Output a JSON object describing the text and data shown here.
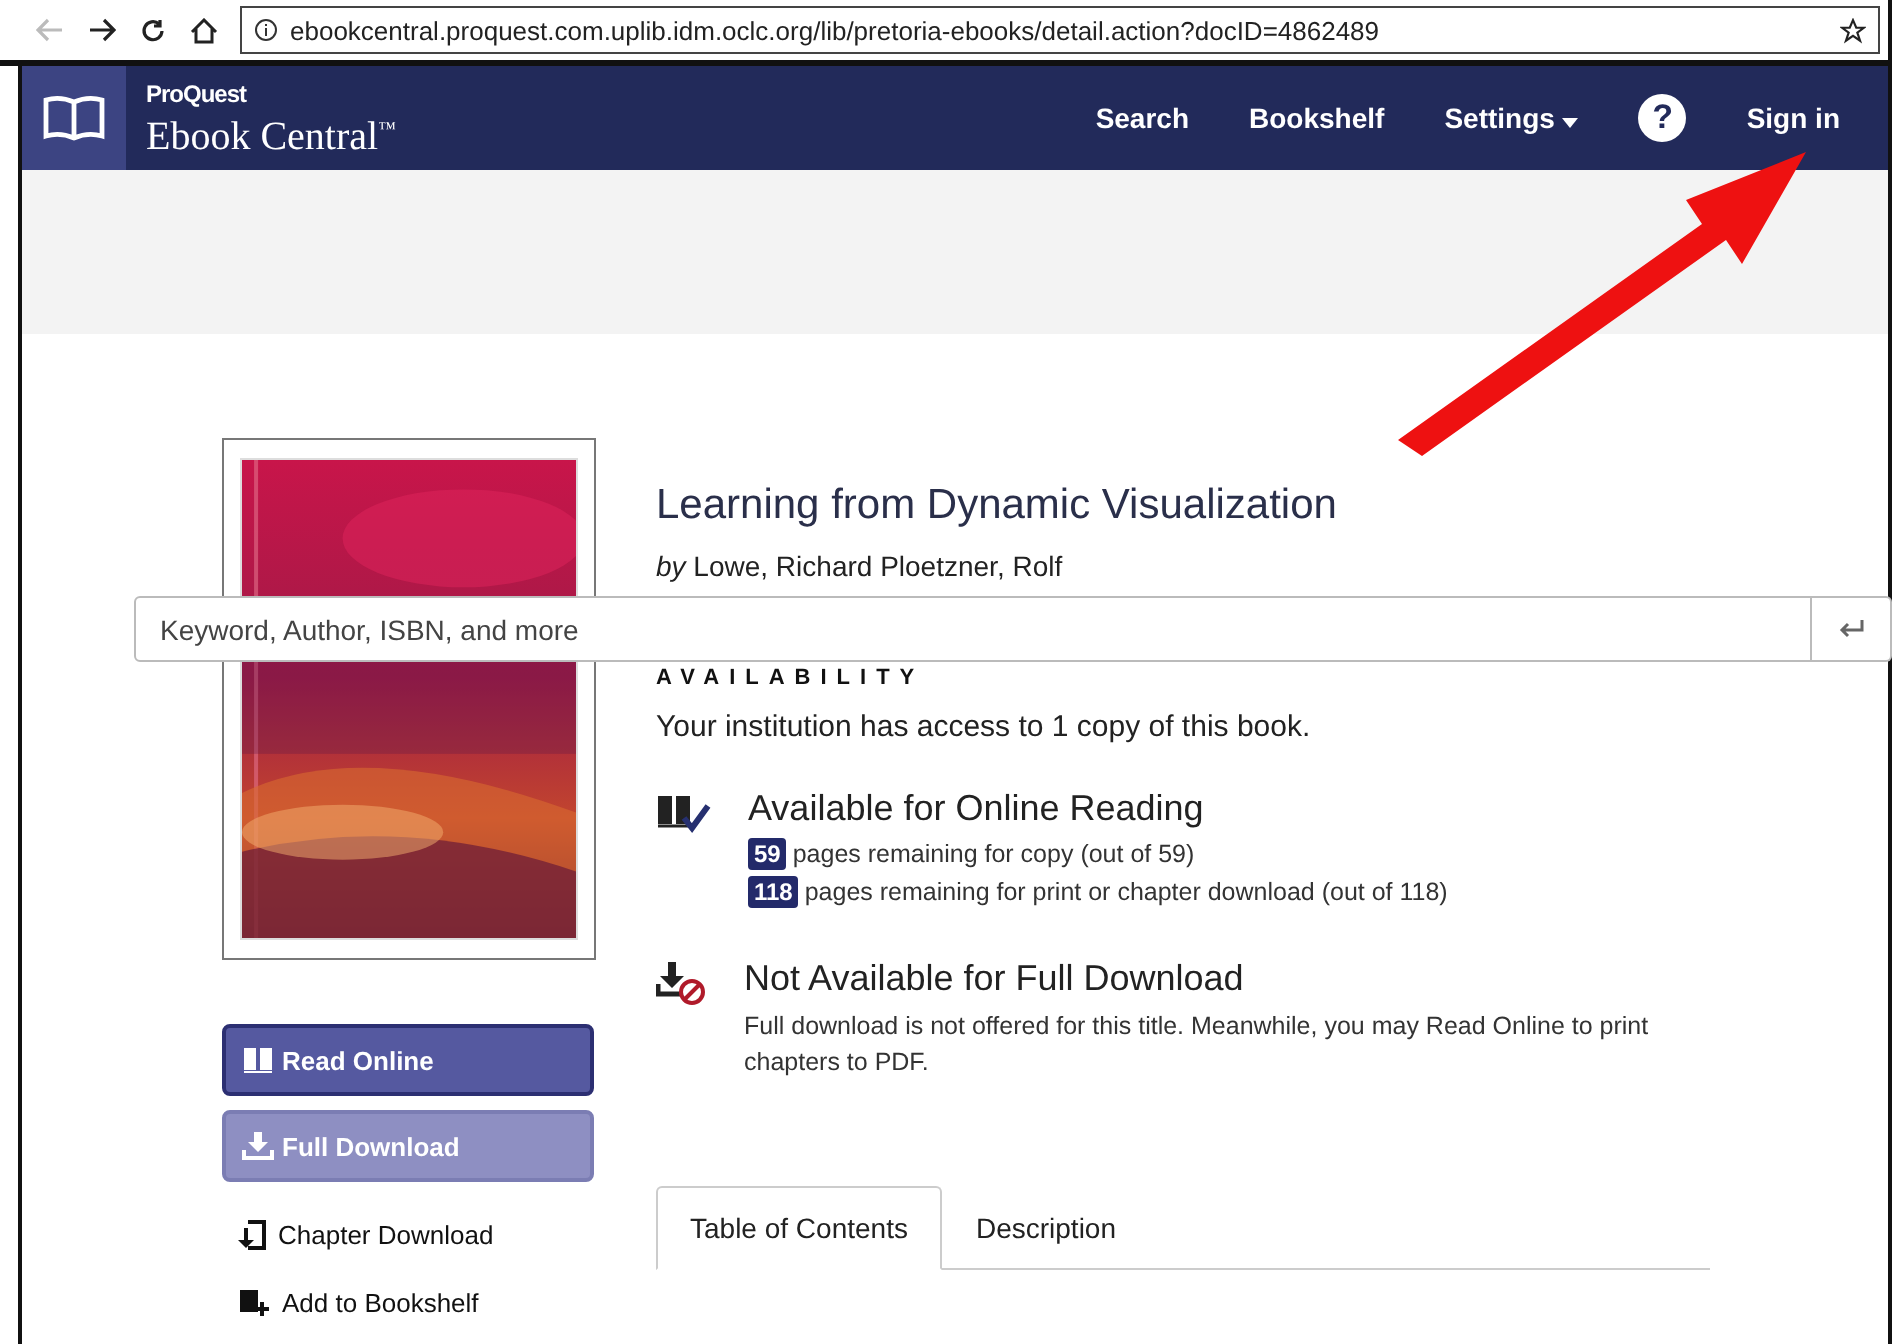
{
  "browser": {
    "url": "ebookcentral.proquest.com.uplib.idm.oclc.org/lib/pretoria-ebooks/detail.action?docID=4862489"
  },
  "header": {
    "brand_small": "ProQuest",
    "brand": "Ebook Central",
    "trademark": "™",
    "nav": [
      {
        "label": "Search",
        "kind": "link"
      },
      {
        "label": "Bookshelf",
        "kind": "link"
      },
      {
        "label": "Settings",
        "kind": "menu"
      },
      {
        "label": "?",
        "kind": "help"
      },
      {
        "label": "Sign in",
        "kind": "link"
      }
    ]
  },
  "book": {
    "title": "Learning from Dynamic Visualization",
    "byline": "*by* Lowe, Richard Ploetzner, Rolf"
  },
  "search": {
    "placeholder": "Keyword, Author, ISBN, and more"
  },
  "availability": {
    "heading": "AVAILABILITY",
    "summary": "Your institution has access to 1 copy of this book.",
    "sections": [
      {
        "kind": "available",
        "title": "Available for Online Reading",
        "lines": [
          {
            "badge": "59",
            "text": "pages remaining for copy (out of 59)"
          },
          {
            "badge": "118",
            "text": "pages remaining for print or chapter download (out of 118)"
          }
        ]
      },
      {
        "kind": "unavailable",
        "title": "Not Available for Full Download",
        "text": "Full download is not offered for this title. Meanwhile, you may Read Online to print chapters to PDF."
      }
    ]
  },
  "actions": [
    {
      "label": "Read Online",
      "kind": "button",
      "disabled": false
    },
    {
      "label": "Full Download",
      "kind": "button",
      "disabled": true
    },
    {
      "label": "Chapter Download",
      "kind": "link"
    },
    {
      "label": "Add to Bookshelf",
      "kind": "link"
    }
  ],
  "tabs": [
    {
      "label": "Table of Contents",
      "selected": true
    },
    {
      "label": "Description",
      "selected": false
    }
  ]
}
